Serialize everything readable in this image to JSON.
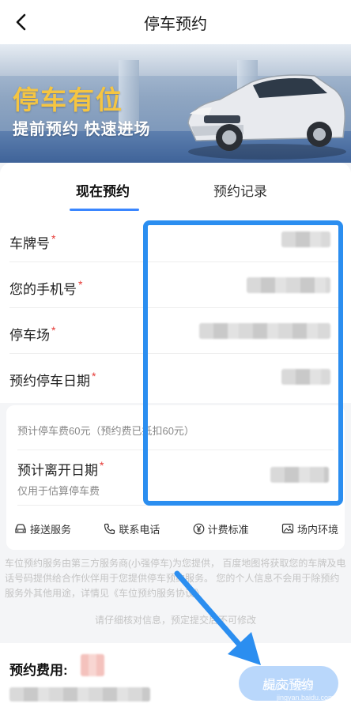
{
  "navbar": {
    "title": "停车预约"
  },
  "banner": {
    "headline": "停车有位",
    "subline": "提前预约 快速进场"
  },
  "tabs": [
    {
      "label": "现在预约",
      "active": true
    },
    {
      "label": "预约记录",
      "active": false
    }
  ],
  "form": {
    "fields": [
      {
        "label": "车牌号",
        "required": "*"
      },
      {
        "label": "您的手机号",
        "required": "*"
      },
      {
        "label": "停车场",
        "required": "*"
      },
      {
        "label": "预约停车日期",
        "required": "*"
      }
    ]
  },
  "fee_card": {
    "estimate_text": "预计停车费60元（预约费已抵扣60元）",
    "leave_label": "预计离开日期",
    "leave_required": "*",
    "leave_hint": "仅用于估算停车费",
    "services": [
      {
        "label": "接送服务",
        "icon": "car-icon"
      },
      {
        "label": "联系电话",
        "icon": "phone-icon"
      },
      {
        "label": "计费标准",
        "icon": "yuan-icon"
      },
      {
        "label": "场内环境",
        "icon": "image-icon"
      }
    ]
  },
  "disclaimer": {
    "text": "车位预约服务由第三方服务商(小强停车)为您提供， 百度地图将获取您的车牌及电话号码提供给合作伙伴用于您提供停车预约服务。 您的个人信息不会用于除预约服务外其他用途，详情见《车位预约服务协议》",
    "confirm": "请仔细核对信息，预定提交后不可修改"
  },
  "bottom": {
    "fee_label": "预约费用:",
    "submit_label": "提交预约"
  },
  "watermark": {
    "text": "Baidu 经验",
    "sub": "jingyan.baidu.com"
  },
  "colors": {
    "accent": "#3a86ff",
    "highlight": "#2b8ef0",
    "required": "#e53935",
    "submit_bg": "#b9d7fb"
  }
}
